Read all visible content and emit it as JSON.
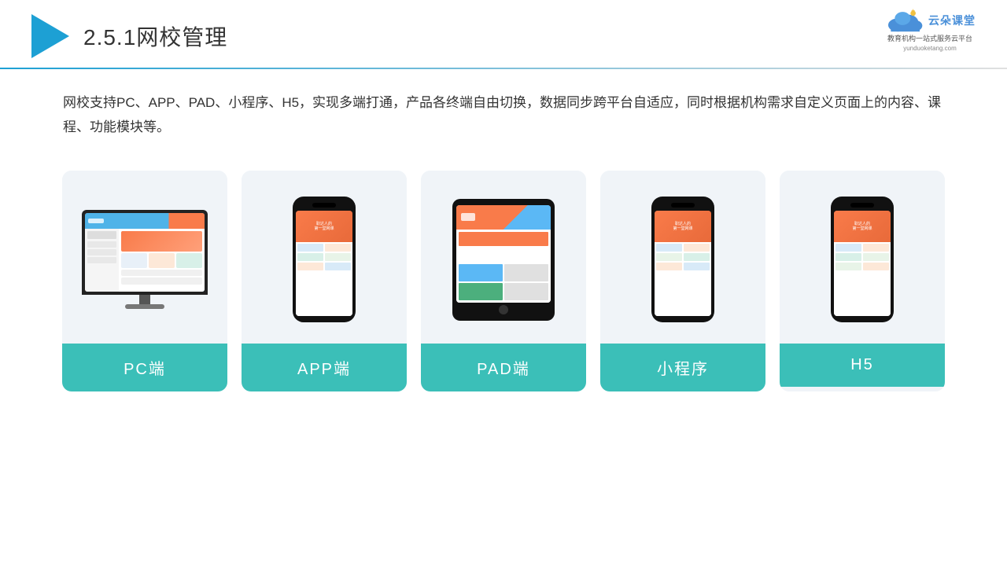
{
  "header": {
    "title": "2.5.1网校管理",
    "brand": {
      "name": "云朵课堂",
      "url": "yunduoketang.com",
      "tagline": "教育机构一站\n式服务云平台"
    }
  },
  "description": {
    "text": "网校支持PC、APP、PAD、小程序、H5，实现多端打通，产品各终端自由切换，数据同步跨平台自适应，同时根据机构需求自定义页面上的内容、课程、功能模块等。"
  },
  "cards": [
    {
      "id": "pc",
      "label": "PC端",
      "type": "pc"
    },
    {
      "id": "app",
      "label": "APP端",
      "type": "phone"
    },
    {
      "id": "pad",
      "label": "PAD端",
      "type": "tablet"
    },
    {
      "id": "mini",
      "label": "小程序",
      "type": "phone"
    },
    {
      "id": "h5",
      "label": "H5",
      "type": "phone"
    }
  ],
  "colors": {
    "accent": "#3bbfb8",
    "header_blue": "#1da0d4",
    "brand_blue": "#4a90d9"
  }
}
